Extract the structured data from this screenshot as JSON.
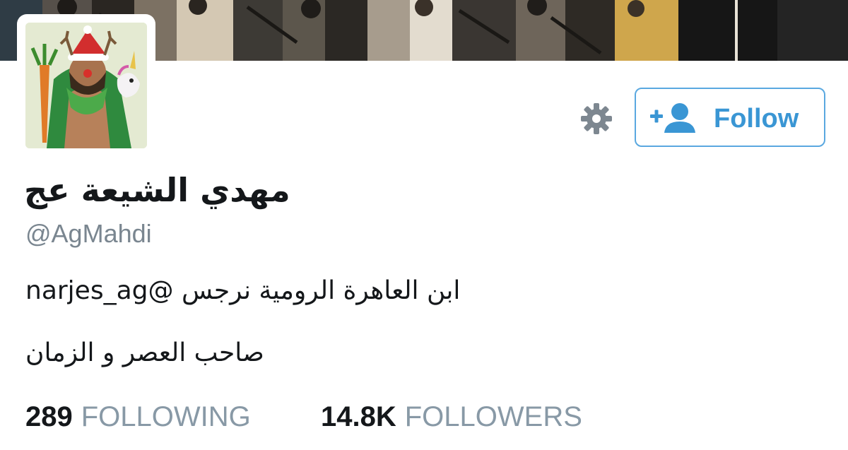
{
  "profile": {
    "display_name": "مهدي الشيعة عج",
    "handle": "@AgMahdi",
    "bio_line1": "ابن العاهرة الرومية نرجس @narjes_ag",
    "bio_line2": "صاحب العصر و الزمان"
  },
  "actions": {
    "follow_label": "Follow",
    "settings_icon": "gear-icon",
    "follow_icon": "add-user-icon"
  },
  "stats": {
    "following_count": "289",
    "following_label": "FOLLOWING",
    "followers_count": "14.8K",
    "followers_label": "FOLLOWERS"
  },
  "colors": {
    "accent": "#3a96d4",
    "muted": "#8899a6",
    "text": "#14171a"
  }
}
